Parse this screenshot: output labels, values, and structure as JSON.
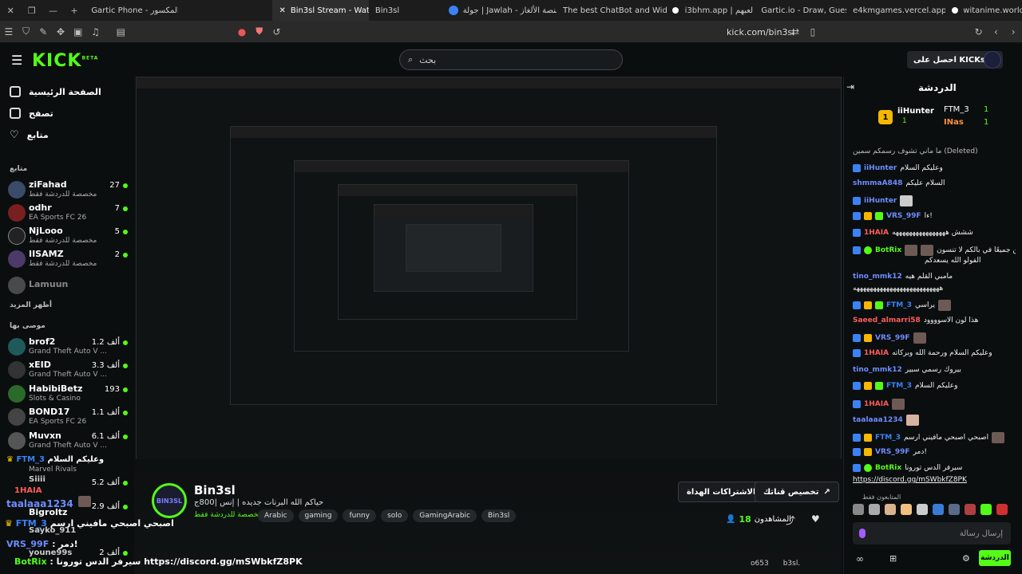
{
  "browser": {
    "tabs": [
      {
        "label": "Gartic Phone - شف المكسور"
      },
      {
        "label": "Bin3sl Stream - Watch",
        "active": true
      },
      {
        "label": "Bin3sl"
      },
      {
        "label": "جولة | Jawlah - منصة الألغاز"
      },
      {
        "label": "The best ChatBot and Wid"
      },
      {
        "label": "i3bhm.app | لعبهم"
      },
      {
        "label": "Gartic.io - Draw, Guess, W"
      },
      {
        "label": "e4kmgames.vercel.app/ga"
      },
      {
        "label": "witanime.world"
      }
    ],
    "url": "kick.com/bin3sl"
  },
  "header": {
    "logo": "KICK",
    "logo_sup": "BETA",
    "search_placeholder": "بحث",
    "get_kicks": "احصل على KICKs"
  },
  "sidebar": {
    "nav": [
      {
        "label": "الصفحة الرئيسية",
        "icon": "home-icon"
      },
      {
        "label": "تصفح",
        "icon": "browse-icon"
      },
      {
        "label": "متابع",
        "icon": "heart-icon"
      }
    ],
    "following_title": "متابع",
    "following": [
      {
        "name": "ziFahad",
        "sub": "مخصصة للدردشة فقط",
        "count": "27"
      },
      {
        "name": "odhr",
        "sub": "EA Sports FC 26",
        "count": "7"
      },
      {
        "name": "NjLooo",
        "sub": "مخصصة للدردشة فقط",
        "count": "5"
      },
      {
        "name": "IISAMZ",
        "sub": "مخصصة للدردشة فقط",
        "count": "2"
      },
      {
        "name": "Lamuun",
        "sub": "",
        "count": ""
      }
    ],
    "show_more": "أظهر المزيد",
    "recommended_title": "موصى بها",
    "recommended": [
      {
        "name": "brof2",
        "sub": "Grand Theft Auto V ...",
        "count": "1.2 ألف"
      },
      {
        "name": "xEID",
        "sub": "Grand Theft Auto V ...",
        "count": "3.3 ألف"
      },
      {
        "name": "HabibiBetz",
        "sub": "Slots & Casino",
        "count": "193"
      },
      {
        "name": "BOND17",
        "sub": "EA Sports FC 26",
        "count": "1.1 ألف"
      },
      {
        "name": "Muvxn",
        "sub": "Grand Theft Auto V ...",
        "count": "6.1 ألف"
      },
      {
        "name": "",
        "sub": "Marvel Rivals",
        "count": ""
      },
      {
        "name": "",
        "sub": "",
        "count": "5.2 ألف"
      },
      {
        "name": "Bigroltz",
        "sub": "",
        "count": "2.9 ألف"
      },
      {
        "name": "",
        "sub": "",
        "count": "2 ألف"
      }
    ]
  },
  "stream": {
    "streamer": "Bin3sl",
    "avatar_text": "BIN3SL",
    "title": "حياكم الله  البرنات جديده | إنس |800ج",
    "category": "مخصصة للدردشة فقط",
    "tags": [
      "Arabic",
      "gaming",
      "funny",
      "solo",
      "GamingArabic",
      "Bin3sl"
    ],
    "btn_channel": "تخصيص قناتك",
    "btn_gift": "الاشتراكات الهداة",
    "viewers_label": "المشاهدون",
    "viewers": "18",
    "followers": "o653",
    "handle": "b3sl."
  },
  "echo_chat": [
    {
      "user": "FTM_3",
      "text": "وعليكم السلام",
      "color": "#3b82f6"
    },
    {
      "user": "Siiii",
      "text": "",
      "color": "#cccccc"
    },
    {
      "user": "1HAIA",
      "text": "",
      "color": "#ff5c5c"
    },
    {
      "user": "taalaaa1234",
      "text": "",
      "color": "#6f8cff"
    },
    {
      "user": "FTM_3",
      "text": "اصبحي اصبحي مافيني ارسم",
      "color": "#3b82f6"
    },
    {
      "user": "Sayko_911",
      "text": "",
      "color": "#cccccc"
    },
    {
      "user": "VRS_99F",
      "text": "دمر!",
      "color": "#6f8cff"
    },
    {
      "user": "youne99s",
      "text": "",
      "color": "#cccccc"
    },
    {
      "user": "BotRix",
      "text": "سيرفر الدس تورونا",
      "color": "#53fc18"
    },
    {
      "user": "",
      "text": "https://discord.gg/mSWbkfZ8PK",
      "color": "#ffffff"
    }
  ],
  "chat": {
    "title": "الدردشة",
    "pinned": [
      {
        "user": "iiHunter",
        "count": "1"
      },
      {
        "user": "FTM_3",
        "count": "1"
      },
      {
        "user": "INas",
        "count": "1"
      }
    ],
    "messages": [
      {
        "user": "",
        "text": "ما ماني تشوف رسمكم سمين (Deleted)",
        "color": "#cccccc"
      },
      {
        "user": "iiHunter",
        "text": "وعليكم السلام",
        "color": "#6f8cff"
      },
      {
        "user": "shmmaA848",
        "text": "السلام عليكم",
        "color": "#6f8cff"
      },
      {
        "user": "iiHunter",
        "text": "",
        "color": "#6f8cff"
      },
      {
        "user": "VRS_99F",
        "text": "ءا!",
        "color": "#6f8cff"
      },
      {
        "user": "1HAIA",
        "text": "ششش ههههههههههههههههه",
        "color": "#ff5c5c"
      },
      {
        "user": "BotRix",
        "text": "متورين جميعًا في بالكم لا تنسون",
        "color": "#53fc18"
      },
      {
        "user": "",
        "text": "الفولو الله يسعدكم",
        "color": "#eeeeee"
      },
      {
        "user": "tino_mmk12",
        "text": "مامبي القلم هيه",
        "color": "#6f8cff"
      },
      {
        "user": "",
        "text": "ههههههههههههههههههههههههههه",
        "color": "#eeeeee"
      },
      {
        "user": "FTM_3",
        "text": "يراسي",
        "color": "#3b82f6"
      },
      {
        "user": "Saeed_almarri58",
        "text": "هذا لون الاسوووود",
        "color": "#ff5c5c"
      },
      {
        "user": "VRS_99F",
        "text": "",
        "color": "#6f8cff"
      },
      {
        "user": "1HAIA",
        "text": "وعليكم السلام ورحمة الله وبركاته",
        "color": "#ff5c5c"
      },
      {
        "user": "tino_mmk12",
        "text": "بيروك رسمي سبير",
        "color": "#6f8cff"
      },
      {
        "user": "FTM_3",
        "text": "وعليكم السلام",
        "color": "#3b82f6"
      },
      {
        "user": "1HAIA",
        "text": "",
        "color": "#ff5c5c"
      },
      {
        "user": "taalaaa1234",
        "text": "",
        "color": "#6f8cff"
      },
      {
        "user": "FTM_3",
        "text": "اصبحي اصبحي مافيني ارسم",
        "color": "#3b82f6"
      },
      {
        "user": "VRS_99F",
        "text": "دمر!",
        "color": "#6f8cff"
      },
      {
        "user": "BotRix",
        "text": "سيرفر الدس تورونا",
        "color": "#53fc18"
      },
      {
        "user": "",
        "text": "https://discord.gg/mSWbkfZ8PK",
        "color": "#ffffff"
      }
    ],
    "subs_only": "المتابعون فقط",
    "input_placeholder": "إرسال رسالة",
    "send_label": "الدردشة"
  }
}
